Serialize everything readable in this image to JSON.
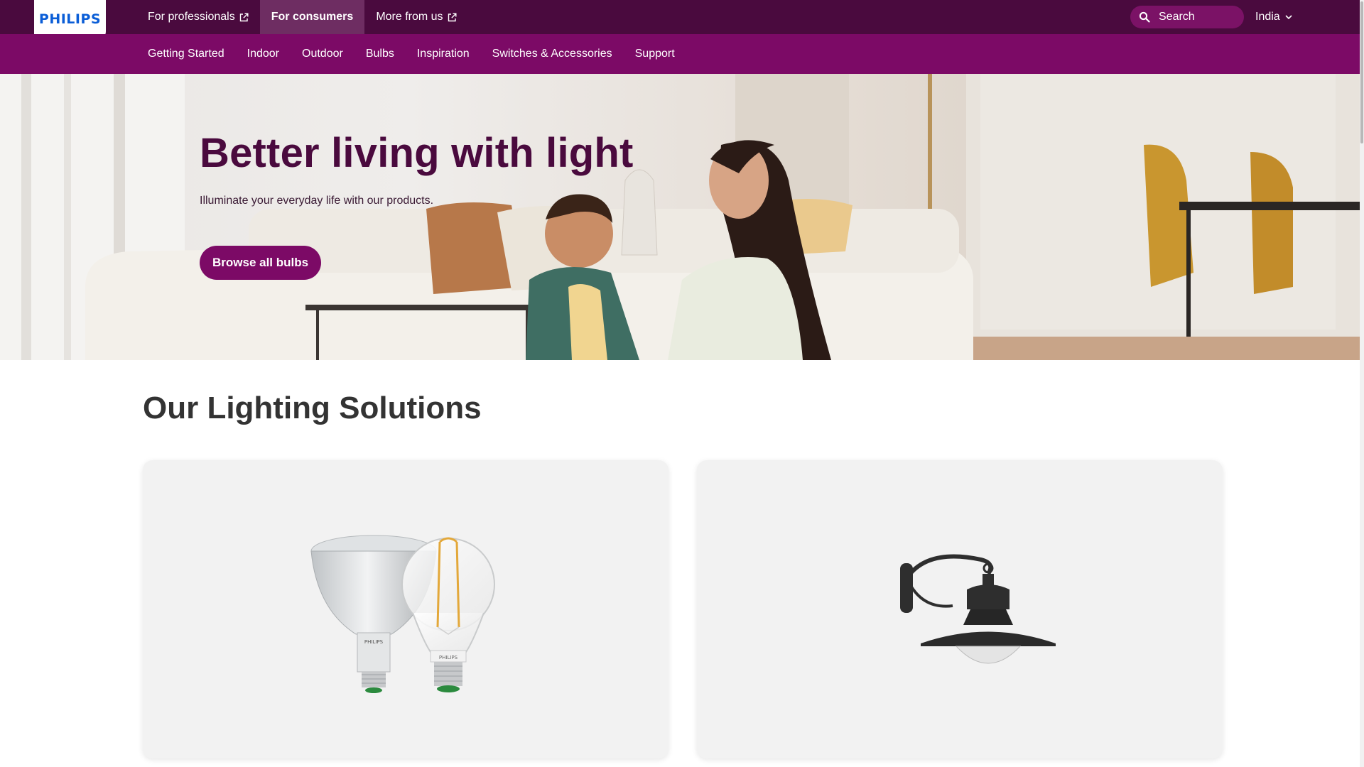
{
  "brand": {
    "logo": "PHILIPS"
  },
  "topnav": {
    "items": [
      {
        "label": "For professionals",
        "icon": "external-link-icon"
      },
      {
        "label": "For consumers",
        "active": true
      },
      {
        "label": "More from us",
        "icon": "external-link-icon"
      }
    ],
    "search": {
      "label": "Search",
      "icon": "search-icon"
    },
    "country": {
      "label": "India",
      "icon": "chevron-down-icon"
    }
  },
  "subnav": {
    "items": [
      {
        "label": "Getting Started"
      },
      {
        "label": "Indoor"
      },
      {
        "label": "Outdoor"
      },
      {
        "label": "Bulbs"
      },
      {
        "label": "Inspiration"
      },
      {
        "label": "Switches & Accessories"
      },
      {
        "label": "Support"
      }
    ]
  },
  "hero": {
    "title": "Better living with light",
    "subtitle": "Illuminate your everyday life with our products.",
    "cta": "Browse all bulbs"
  },
  "solutions": {
    "title": "Our Lighting Solutions",
    "cards": [
      {
        "image": "bulbs-image",
        "bulb_brand": "PHILIPS"
      },
      {
        "image": "outdoor-wall-lamp-image"
      }
    ]
  },
  "colors": {
    "topbar": "#4a0a3e",
    "subnav": "#7c0a66",
    "accent": "#7c0a66",
    "hero_title": "#4a0a3e",
    "logo_blue": "#0b5ed7"
  }
}
